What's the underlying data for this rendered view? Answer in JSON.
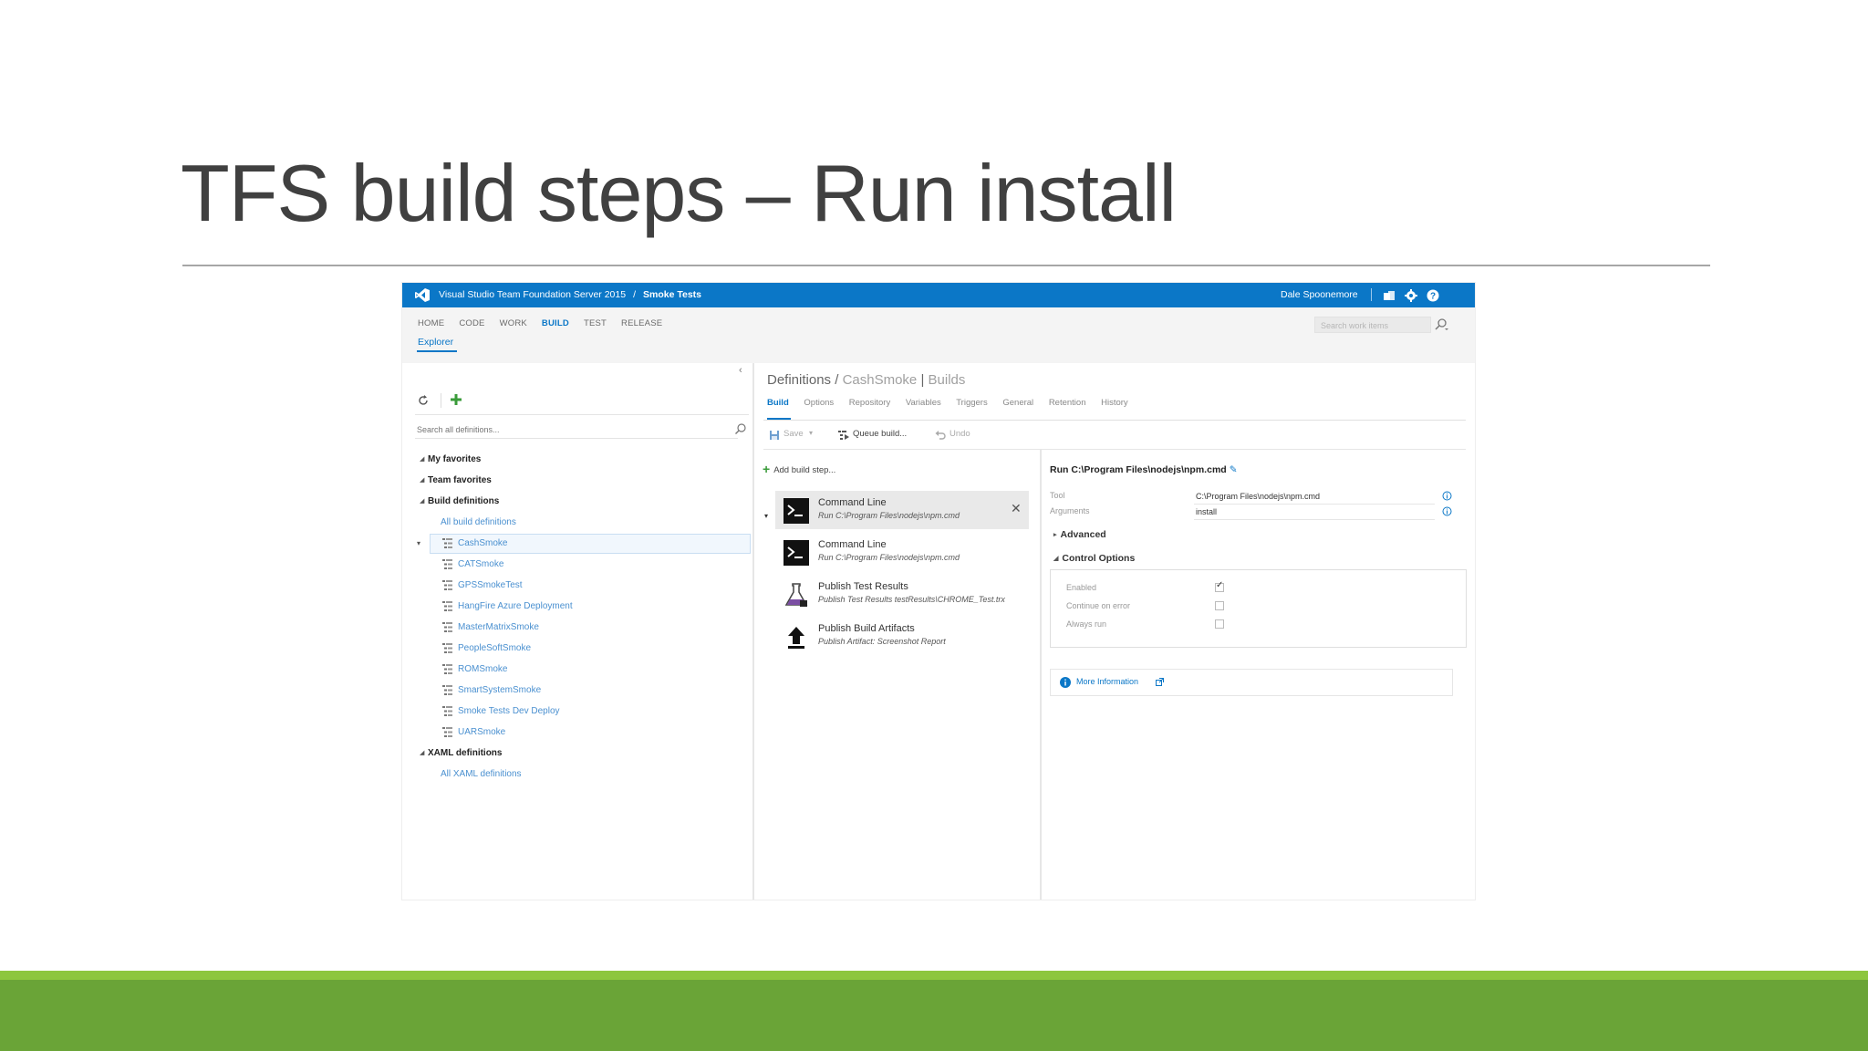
{
  "slide": {
    "title": "TFS build steps – Run install"
  },
  "tfs": {
    "header": {
      "product": "Visual Studio Team Foundation Server 2015",
      "separator": "/",
      "project": "Smoke Tests",
      "user": "Dale Spoonemore"
    },
    "nav": {
      "items": [
        "HOME",
        "CODE",
        "WORK",
        "BUILD",
        "TEST",
        "RELEASE"
      ],
      "active": "BUILD",
      "subnav": "Explorer",
      "search_placeholder": "Search work items"
    },
    "left_panel": {
      "filter_placeholder": "Search all definitions...",
      "groups": {
        "my_favorites": "My favorites",
        "team_favorites": "Team favorites",
        "build_definitions": "Build definitions",
        "all_build_definitions": "All build definitions",
        "xaml_definitions": "XAML definitions",
        "all_xaml_definitions": "All XAML definitions"
      },
      "definitions": [
        "CashSmoke",
        "CATSmoke",
        "GPSSmokeTest",
        "HangFire Azure Deployment",
        "MasterMatrixSmoke",
        "PeopleSoftSmoke",
        "ROMSmoke",
        "SmartSystemSmoke",
        "Smoke Tests Dev Deploy",
        "UARSmoke"
      ],
      "selected_definition": "CashSmoke"
    },
    "breadcrumb": {
      "root": "Definitions",
      "sep": "/",
      "definition": "CashSmoke",
      "pipe": "|",
      "section": "Builds"
    },
    "tabs": [
      "Build",
      "Options",
      "Repository",
      "Variables",
      "Triggers",
      "General",
      "Retention",
      "History"
    ],
    "active_tab": "Build",
    "toolbar": {
      "save": "Save",
      "queue": "Queue build...",
      "undo": "Undo"
    },
    "add_step_label": "Add build step...",
    "steps": [
      {
        "title": "Command Line",
        "subtitle": "Run C:\\Program Files\\nodejs\\npm.cmd",
        "icon": "terminal-icon",
        "selected": true
      },
      {
        "title": "Command Line",
        "subtitle": "Run C:\\Program Files\\nodejs\\npm.cmd",
        "icon": "terminal-icon",
        "selected": false
      },
      {
        "title": "Publish Test Results",
        "subtitle": "Publish Test Results testResults\\CHROME_Test.trx",
        "icon": "flask-icon",
        "selected": false
      },
      {
        "title": "Publish Build Artifacts",
        "subtitle": "Publish Artifact: Screenshot Report",
        "icon": "upload-arrow-icon",
        "selected": false
      }
    ],
    "details": {
      "title": "Run C:\\Program Files\\nodejs\\npm.cmd",
      "tool_label": "Tool",
      "tool_value": "C:\\Program Files\\nodejs\\npm.cmd",
      "args_label": "Arguments",
      "args_value": "install",
      "advanced": "Advanced",
      "control_options": "Control Options",
      "enabled_label": "Enabled",
      "enabled": true,
      "continue_label": "Continue on error",
      "continue_on_error": false,
      "always_label": "Always run",
      "always_run": false,
      "more_info": "More Information"
    }
  },
  "colors": {
    "tfs_blue": "#0b77c7",
    "footer_green": "#6aa437",
    "footer_light_green": "#8dc63f",
    "title_gray": "#404040"
  }
}
